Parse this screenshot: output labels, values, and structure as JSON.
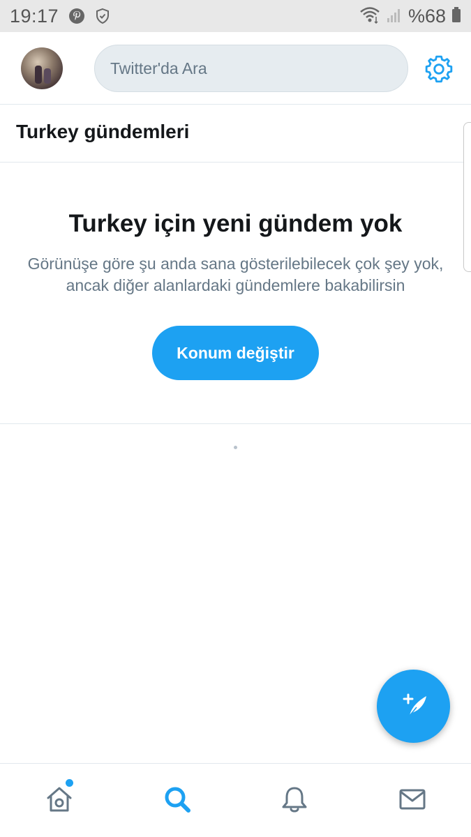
{
  "status_bar": {
    "time": "19:17",
    "battery": "%68",
    "icons": [
      "pinterest-icon",
      "shield-icon",
      "wifi-icon",
      "signal-icon",
      "battery-icon"
    ]
  },
  "header": {
    "search_placeholder": "Twitter'da Ara",
    "icons": [
      "avatar",
      "gear-icon"
    ]
  },
  "trends": {
    "title": "Turkey gündemleri"
  },
  "empty_state": {
    "title": "Turkey için yeni gündem yok",
    "description": "Görünüşe göre şu anda sana gösterilebilecek çok şey yok, ancak diğer alanlardaki gündemlere bakabilirsin",
    "button_label": "Konum değiştir"
  },
  "fab": {
    "icon": "compose-tweet-icon"
  },
  "bottom_nav": {
    "items": [
      "home-icon",
      "search-icon",
      "bell-icon",
      "mail-icon"
    ],
    "active": "search-icon"
  },
  "colors": {
    "accent": "#1da1f2",
    "text_primary": "#14171a",
    "text_secondary": "#657786",
    "search_bg": "#e6ecf0",
    "status_bar_bg": "#e8e8e8"
  }
}
